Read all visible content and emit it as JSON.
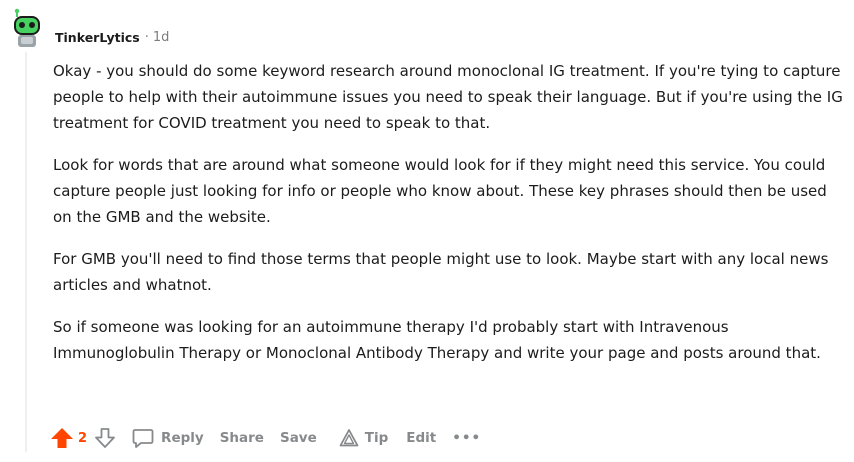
{
  "comment": {
    "author": "TinkerLytics",
    "separator": "·",
    "age": "1d",
    "paragraphs": [
      "Okay - you should do some keyword research around monoclonal IG treatment. If you're tying to capture people to help with their autoimmune issues you need to speak their language. But if you're using the IG treatment for COVID treatment you need to speak to that.",
      "Look for words that are around what someone would look for if they might need this service. You could capture people just looking for info or people who know about. These key phrases should then be used on the GMB and the website.",
      "For GMB you'll need to find those terms that people might use to look. Maybe start with any local news articles and whatnot.",
      "So if someone was looking for an autoimmune therapy I'd probably start with Intravenous Immunoglobulin Therapy or Monoclonal Antibody Therapy and write your page and posts around that."
    ],
    "score": "2",
    "actions": {
      "reply": "Reply",
      "share": "Share",
      "save": "Save",
      "tip": "Tip",
      "edit": "Edit",
      "more": "•••"
    }
  },
  "colors": {
    "upvote": "#ff4500",
    "action_gray": "#878a8c",
    "avatar_green": "#46d160"
  },
  "icons": [
    "avatar-icon",
    "upvote-arrow-icon",
    "downvote-arrow-icon",
    "comment-bubble-icon",
    "tip-triangle-icon",
    "more-dots-icon"
  ]
}
